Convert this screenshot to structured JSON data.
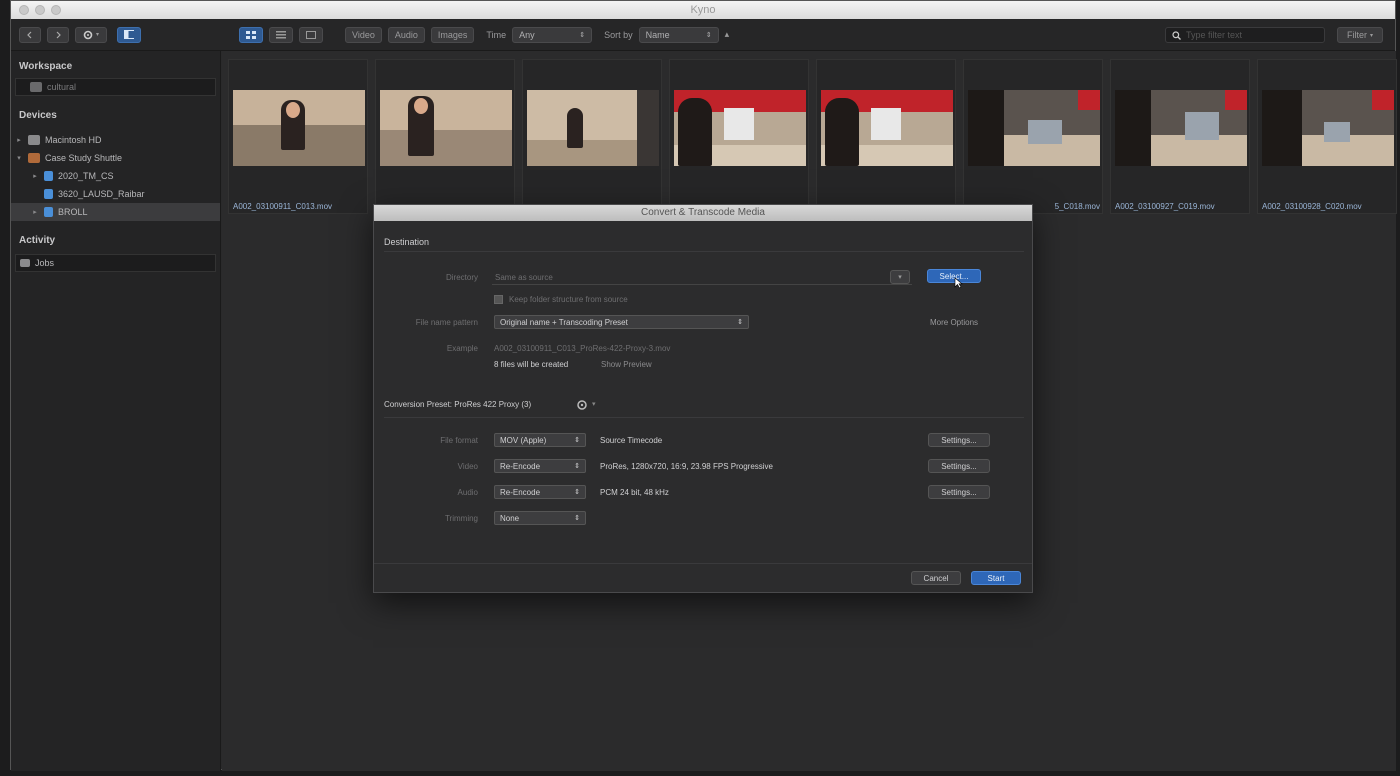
{
  "window": {
    "title": "Kyno"
  },
  "toolbar": {
    "filters": [
      "Video",
      "Audio",
      "Images"
    ],
    "time_label": "Time",
    "time_value": "Any",
    "sort_label": "Sort by",
    "sort_value": "Name",
    "search_placeholder": "Type filter text",
    "filter_label": "Filter"
  },
  "sidebar": {
    "workspace_h": "Workspace",
    "workspace_item": "cultural",
    "devices_h": "Devices",
    "devices": [
      {
        "label": "Macintosh HD"
      },
      {
        "label": "Case Study Shuttle"
      },
      {
        "label": "2020_TM_CS"
      },
      {
        "label": "3620_LAUSD_Raibar"
      },
      {
        "label": "BROLL"
      }
    ],
    "activity_h": "Activity",
    "activity_item": "Jobs"
  },
  "thumbnails": [
    {
      "name": "A002_03100911_C013.mov"
    },
    {
      "name": ""
    },
    {
      "name": ""
    },
    {
      "name": ""
    },
    {
      "name": ""
    },
    {
      "name": "5_C018.mov"
    },
    {
      "name": "A002_03100927_C019.mov"
    },
    {
      "name": "A002_03100928_C020.mov"
    }
  ],
  "dialog": {
    "title": "Convert & Transcode Media",
    "destination_h": "Destination",
    "directory_label": "Directory",
    "directory_value": "Same as source",
    "directory_btn": "Select...",
    "keep_structure": "Keep folder structure from source",
    "pattern_label": "File name pattern",
    "pattern_value": "Original name + Transcoding Preset",
    "more_options": "More Options",
    "example_label": "Example",
    "example_value": "A002_03100911_C013_ProRes-422-Proxy-3.mov",
    "files_created": "8 files will be created",
    "show_preview": "Show Preview",
    "preset_h": "Conversion Preset: ProRes 422 Proxy (3)",
    "rows": [
      {
        "label": "File format",
        "select": "MOV (Apple)",
        "desc": "Source Timecode",
        "btn": "Settings..."
      },
      {
        "label": "Video",
        "select": "Re-Encode",
        "desc": "ProRes, 1280x720, 16:9, 23.98 FPS Progressive",
        "btn": "Settings..."
      },
      {
        "label": "Audio",
        "select": "Re-Encode",
        "desc": "PCM 24 bit, 48 kHz",
        "btn": "Settings..."
      },
      {
        "label": "Trimming",
        "select": "None",
        "desc": "",
        "btn": ""
      }
    ],
    "cancel": "Cancel",
    "start": "Start"
  }
}
